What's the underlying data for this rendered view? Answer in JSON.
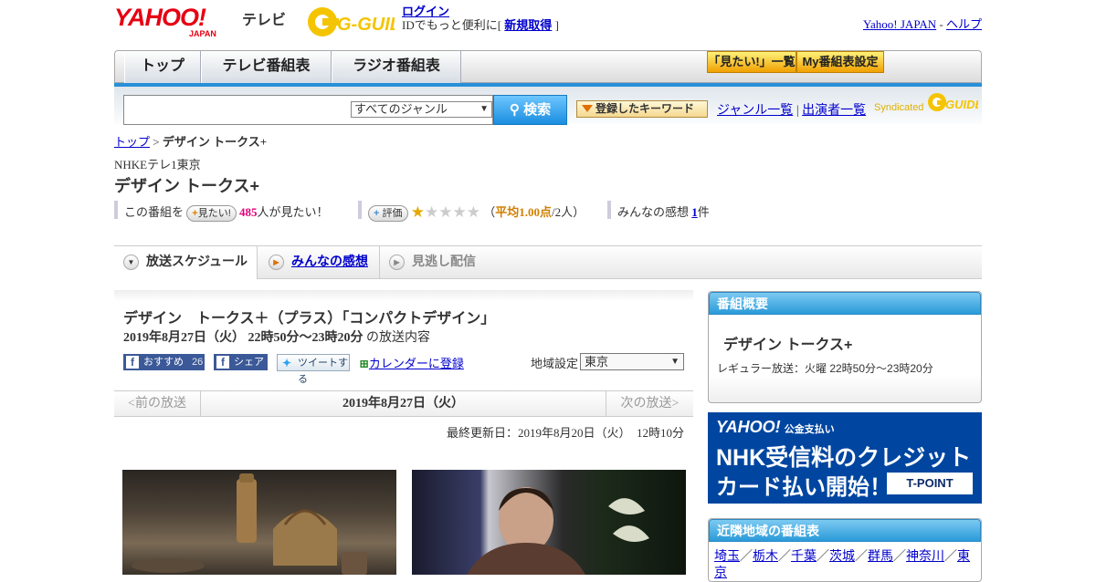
{
  "header": {
    "brand": "YAHOO!",
    "brand_sub": "JAPAN",
    "service": "テレビ",
    "gguide": "G-GUIDE",
    "login_label": "ログイン",
    "login_promo": "IDでもっと便利に[",
    "register_label": "新規取得",
    "login_promo_end": "]",
    "yahoo_japan_link": "Yahoo! JAPAN",
    "link_sep": "-",
    "help_link": "ヘルプ"
  },
  "nav": {
    "tabs": [
      "トップ",
      "テレビ番組表",
      "ラジオ番組表"
    ],
    "want_list": "「見たい!」一覧",
    "my_settings": "My番組表設定"
  },
  "search": {
    "input_value": "",
    "genre_select": "すべてのジャンル",
    "button": "検索",
    "keyword_button": "登録したキーワード",
    "genre_list": "ジャンル一覧",
    "sep": "|",
    "performer_list": "出演者一覧",
    "syndicated": "Syndicated"
  },
  "breadcrumb": {
    "top": "トップ",
    "sep": ">",
    "current": "デザイン トークス+"
  },
  "program": {
    "station": "NHKEテレ1東京",
    "title": "デザイン トークス+",
    "want_prefix": "この番組を",
    "want_button": "見たい!",
    "want_count": "485",
    "want_suffix": "人が見たい！",
    "rate_button": "評価",
    "rating_stars": 1,
    "rating_open": "（",
    "rating_avg": "平均1.00点",
    "rating_count": "/2人）",
    "reviews_label": "みんなの感想",
    "reviews_count": "1",
    "reviews_unit": "件"
  },
  "tabs": {
    "schedule": "放送スケジュール",
    "reviews": "みんなの感想",
    "vod": "見逃し配信"
  },
  "episode": {
    "title": "デザイン　トークス＋（プラス）「コンパクトデザイン」",
    "date": "2019年8月27日（火）",
    "time": "22時50分～23時20分",
    "date_suffix": "の放送内容",
    "recommend_label": "おすすめ",
    "recommend_count": "26",
    "share_label": "シェア",
    "tweet_label": "ツイートする",
    "calendar_label": "カレンダーに登録",
    "region_label": "地域設定",
    "region_value": "東京",
    "prev": "<前の放送",
    "current_date": "2019年8月27日（火）",
    "next": "次の放送>",
    "updated": "最終更新日：2019年8月20日（火）　12時10分"
  },
  "sidebar": {
    "summary_head": "番組概要",
    "summary_title": "デザイン トークス+",
    "summary_schedule": "レギュラー放送：火曜 22時50分～23時20分",
    "ad_line1": "YAHOO!",
    "ad_line1_sub": "公金支払い",
    "ad_line2": "NHK受信料のクレジット",
    "ad_line3": "カード払い開始！",
    "ad_badge": "T-POINT",
    "nearby_head": "近隣地域の番組表",
    "nearby": [
      "埼玉",
      "栃木",
      "千葉",
      "茨城",
      "群馬",
      "神奈川",
      "東京"
    ],
    "nearby_sep": "／"
  },
  "colors": {
    "accent_blue": "#2a9ad8",
    "brand_red": "#e60012",
    "link": "#0000cc",
    "star": "#e6a800"
  }
}
